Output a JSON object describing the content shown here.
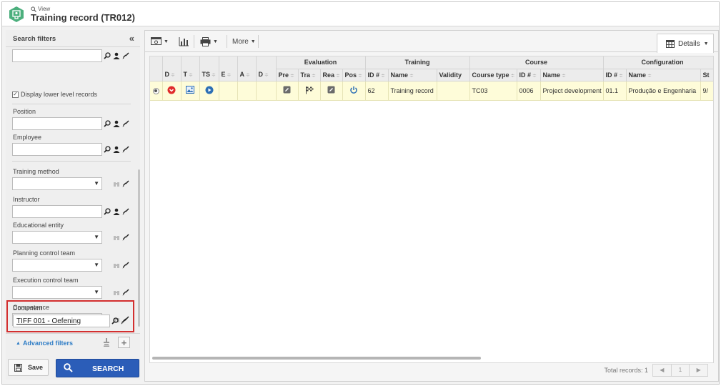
{
  "header": {
    "view_label": "View",
    "title": "Training record (TR012)"
  },
  "search_filters": {
    "title": "Search filters",
    "display_lower_level": "Display lower level records",
    "display_lower_level_checked": true,
    "fields": {
      "position": "Position",
      "employee": "Employee",
      "training_method": "Training method",
      "instructor": "Instructor",
      "educational_entity": "Educational entity",
      "planning_control_team": "Planning control team",
      "execution_control_team": "Execution control team",
      "competence": "Competence",
      "document": "Document"
    },
    "document_value": "TIFF 001 - Oefening",
    "advanced_filters": "Advanced filters",
    "save_label": "Save",
    "search_label": "SEARCH"
  },
  "toolbar": {
    "more_label": "More",
    "details_label": "Details"
  },
  "grid": {
    "group_headers": {
      "evaluation": "Evaluation",
      "training": "Training",
      "course": "Course",
      "configuration": "Configuration"
    },
    "columns": {
      "d": "D",
      "t": "T",
      "ts": "TS",
      "e": "E",
      "a": "A",
      "d2": "D",
      "pre": "Pre",
      "tra": "Tra",
      "rea": "Rea",
      "pos": "Pos",
      "training_id": "ID #",
      "training_name": "Name",
      "validity": "Validity",
      "course_type": "Course type",
      "course_id": "ID #",
      "course_name": "Name",
      "config_id": "ID #",
      "config_name": "Name",
      "st": "St"
    },
    "row": {
      "training_id": "62",
      "training_name": "Training record",
      "validity": "",
      "course_type": "TC03",
      "course_id": "0006",
      "course_name": "Project development",
      "config_id": "01.1",
      "config_name": "Produção e Engenharia",
      "st": "9/"
    }
  },
  "footer": {
    "total_records": "Total records: 1",
    "page": "1"
  },
  "colors": {
    "accent_blue": "#2b5db8",
    "highlight_red": "#d32f2f",
    "row_yellow": "#fefcd9",
    "logo_green": "#4caf7d"
  }
}
